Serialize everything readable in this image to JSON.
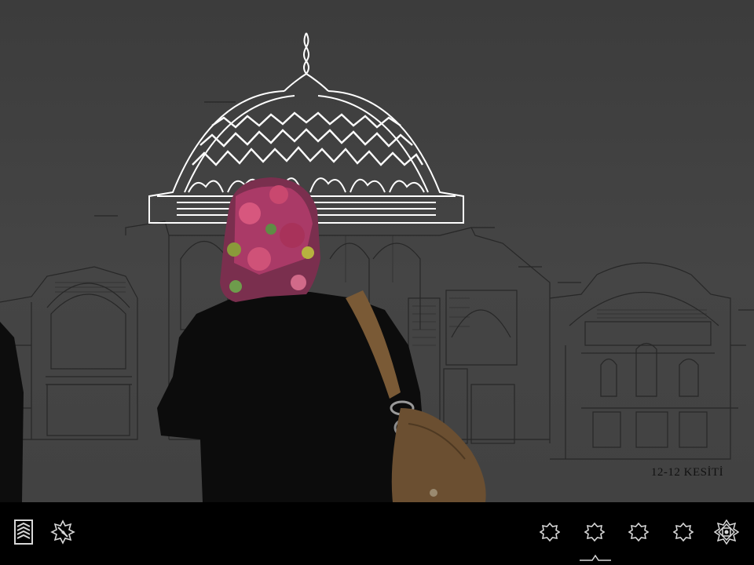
{
  "scene": {
    "caption": "12-12 KESİTİ",
    "background_color": "#404040",
    "drawing_color": "#1a1a1a",
    "highlight_color": "#ffffff"
  },
  "toolbar": {
    "background_color": "#000000",
    "icon_color": "#d8d8d8",
    "left_buttons": [
      {
        "icon": "layers-icon"
      },
      {
        "icon": "compass-icon"
      }
    ],
    "right_buttons": [
      {
        "icon": "star-octagon-icon-1"
      },
      {
        "icon": "star-octagon-icon-2",
        "active": true
      },
      {
        "icon": "star-octagon-icon-3"
      },
      {
        "icon": "star-octagon-icon-4"
      },
      {
        "icon": "ornament-icon"
      }
    ]
  }
}
